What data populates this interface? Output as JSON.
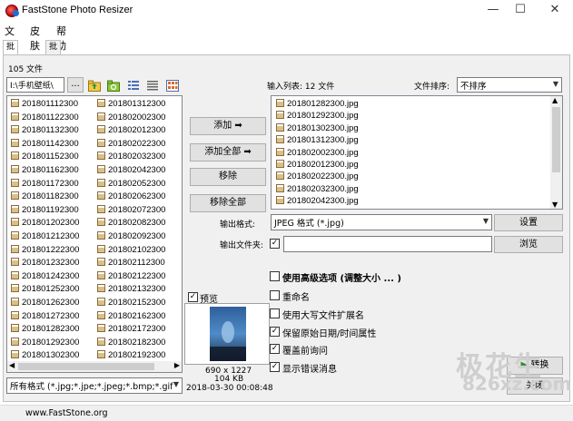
{
  "window": {
    "title": "FastStone Photo Resizer",
    "minimize_glyph": "—",
    "maximize_glyph": "☐",
    "close_glyph": "✕"
  },
  "menu": [
    "文件",
    "皮肤",
    "帮助"
  ],
  "tabs": [
    "批量转换",
    "批量重命名"
  ],
  "source": {
    "file_count": "105 文件",
    "folder_path": "I:\\手机壁纸\\",
    "browse_label": "...",
    "format_filter": "所有格式 (*.jpg;*.jpe;*.jpeg;*.bmp;*.gif",
    "files_col1": [
      "201801112300",
      "201801122300",
      "201801132300",
      "201801142300",
      "201801152300",
      "201801162300",
      "201801172300",
      "201801182300",
      "201801192300",
      "201801202300",
      "201801212300",
      "201801222300",
      "201801232300",
      "201801242300",
      "201801252300",
      "201801262300",
      "201801272300",
      "201801282300",
      "201801292300",
      "201801302300"
    ],
    "files_col2": [
      "201801312300",
      "201802002300",
      "201802012300",
      "201802022300",
      "201802032300",
      "201802042300",
      "201802052300",
      "201802062300",
      "201802072300",
      "201802082300",
      "201802092300",
      "201802102300",
      "201802112300",
      "201802122300",
      "201802132300",
      "201802152300",
      "201802162300",
      "201802172300",
      "201802182300",
      "201802192300"
    ]
  },
  "actions": {
    "add": "添加 ➡",
    "add_all": "添加全部 ➡",
    "remove": "移除",
    "remove_all": "移除全部"
  },
  "input_list": {
    "label": "输入列表:  12  文件",
    "sort_label": "文件排序:",
    "sort_value": "不排序",
    "items": [
      "201801282300.jpg",
      "201801292300.jpg",
      "201801302300.jpg",
      "201801312300.jpg",
      "201802002300.jpg",
      "201802012300.jpg",
      "201802022300.jpg",
      "201802032300.jpg",
      "201802042300.jpg"
    ]
  },
  "output": {
    "format_label": "输出格式:",
    "format_value": "JPEG 格式 (*.jpg)",
    "settings_label": "设置",
    "folder_label": "输出文件夹:",
    "folder_value": "",
    "browse_label": "浏览"
  },
  "options": [
    {
      "label": "使用高级选项 (调整大小 ... )",
      "checked": false,
      "bold": true
    },
    {
      "label": "重命名",
      "checked": false,
      "bold": false
    },
    {
      "label": "使用大写文件扩展名",
      "checked": false,
      "bold": false
    },
    {
      "label": "保留原始日期/时间属性",
      "checked": true,
      "bold": false
    },
    {
      "label": "覆盖前询问",
      "checked": true,
      "bold": false
    },
    {
      "label": "显示错误消息",
      "checked": true,
      "bold": false
    }
  ],
  "preview": {
    "label": "预览",
    "checked": true,
    "dimensions": "690 x 1227",
    "size": "104 KB",
    "date": "2018-03-30 00:08:48"
  },
  "convert": {
    "convert_label": "转换",
    "close_label": "关闭"
  },
  "statusbar": {
    "website": "www.FastStone.org"
  },
  "watermark": {
    "line1": "极花生",
    "line2": "826xz.com"
  },
  "colors": {
    "panel_bg": "#f0f0f0",
    "border": "#bfbfbf"
  }
}
